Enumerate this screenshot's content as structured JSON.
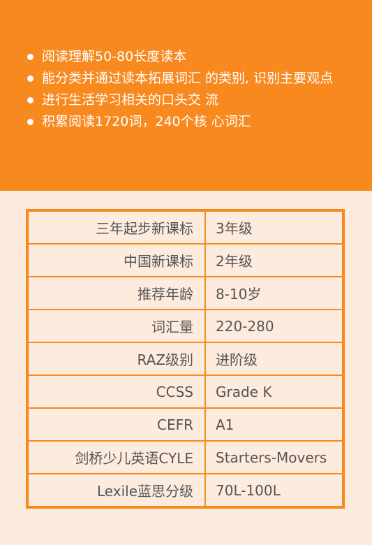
{
  "goals": [
    "阅读理解50-80长度读本",
    "能分类并通过读本拓展词汇 的类别, 识别主要观点",
    "进行生活学习相关的口头交 流",
    "积累阅读1720词，240个核 心词汇"
  ],
  "table": {
    "rows": [
      {
        "label": "三年起步新课标",
        "value": "3年级"
      },
      {
        "label": "中国新课标",
        "value": "2年级"
      },
      {
        "label": "推荐年龄",
        "value": "8-10岁"
      },
      {
        "label": "词汇量",
        "value": "220-280"
      },
      {
        "label": "RAZ级别",
        "value": "进阶级"
      },
      {
        "label": "CCSS",
        "value": "Grade K"
      },
      {
        "label": "CEFR",
        "value": "A1"
      },
      {
        "label": "剑桥少儿英语CYLE",
        "value": "Starters-Movers"
      },
      {
        "label": "Lexile蓝思分级",
        "value": "70L-100L"
      }
    ]
  },
  "colors": {
    "accent": "#F7891F",
    "background": "#FDEBDD",
    "text": "#555555"
  }
}
